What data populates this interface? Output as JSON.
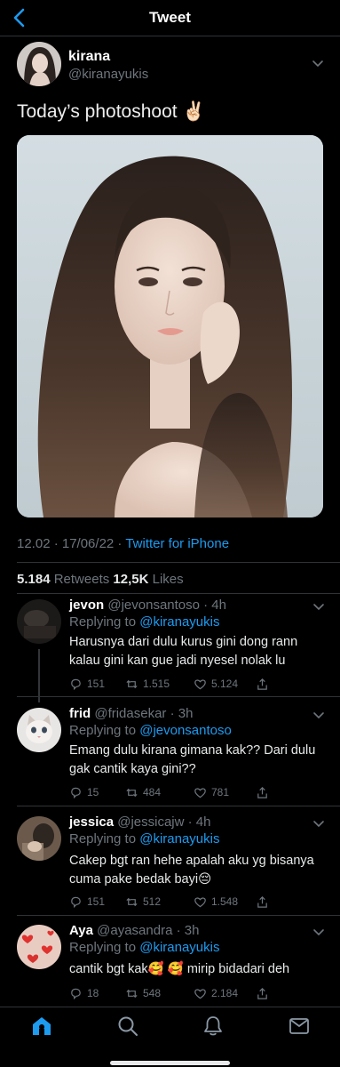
{
  "nav": {
    "title": "Tweet"
  },
  "tweet": {
    "name": "kirana",
    "handle": "@kiranayukis",
    "text": "Today’s photoshoot ✌🏻",
    "time": "12.02 · 17/06/22 · ",
    "source": "Twitter for iPhone",
    "retweets": "5.184",
    "retweets_label": " Retweets ",
    "likes": "12,5K",
    "likes_label": " Likes"
  },
  "replies": [
    {
      "name": "jevon",
      "handle": " @jevonsantoso · 4h",
      "replying_label": "Replying to ",
      "replying_to": "@kiranayukis",
      "text": "Harusnya dari dulu kurus gini dong rann kalau gini kan gue jadi nyesel nolak lu",
      "replies": "151",
      "retweets": "1.515",
      "likes": "5.124"
    },
    {
      "name": "frid",
      "handle": " @fridasekar · 3h",
      "replying_label": "Replying to ",
      "replying_to": "@jevonsantoso",
      "text": "Emang dulu kirana gimana kak?? Dari dulu gak cantik kaya gini??",
      "replies": "15",
      "retweets": "484",
      "likes": "781"
    },
    {
      "name": "jessica",
      "handle": " @jessicajw · 4h",
      "replying_label": "Replying to ",
      "replying_to": "@kiranayukis",
      "text": "Cakep bgt ran hehe apalah aku yg bisanya cuma pake bedak bayi😔",
      "replies": "151",
      "retweets": "512",
      "likes": "1.548"
    },
    {
      "name": "Aya",
      "handle": " @ayasandra · 3h",
      "replying_label": "Replying to ",
      "replying_to": "@kiranayukis",
      "text": "cantik bgt kak🥰 🥰 mirip bidadari deh",
      "replies": "18",
      "retweets": "548",
      "likes": "2.184"
    }
  ],
  "icons": {
    "back": "chevron-left-icon",
    "more": "chevron-down-icon",
    "reply": "reply-icon",
    "retweet": "retweet-icon",
    "like": "heart-icon",
    "share": "share-icon",
    "tabs": [
      "home-icon",
      "search-icon",
      "notifications-icon",
      "messages-icon"
    ]
  },
  "colors": {
    "accent": "#1d9bf0",
    "background": "#000000",
    "secondary_text": "#6e767d"
  }
}
